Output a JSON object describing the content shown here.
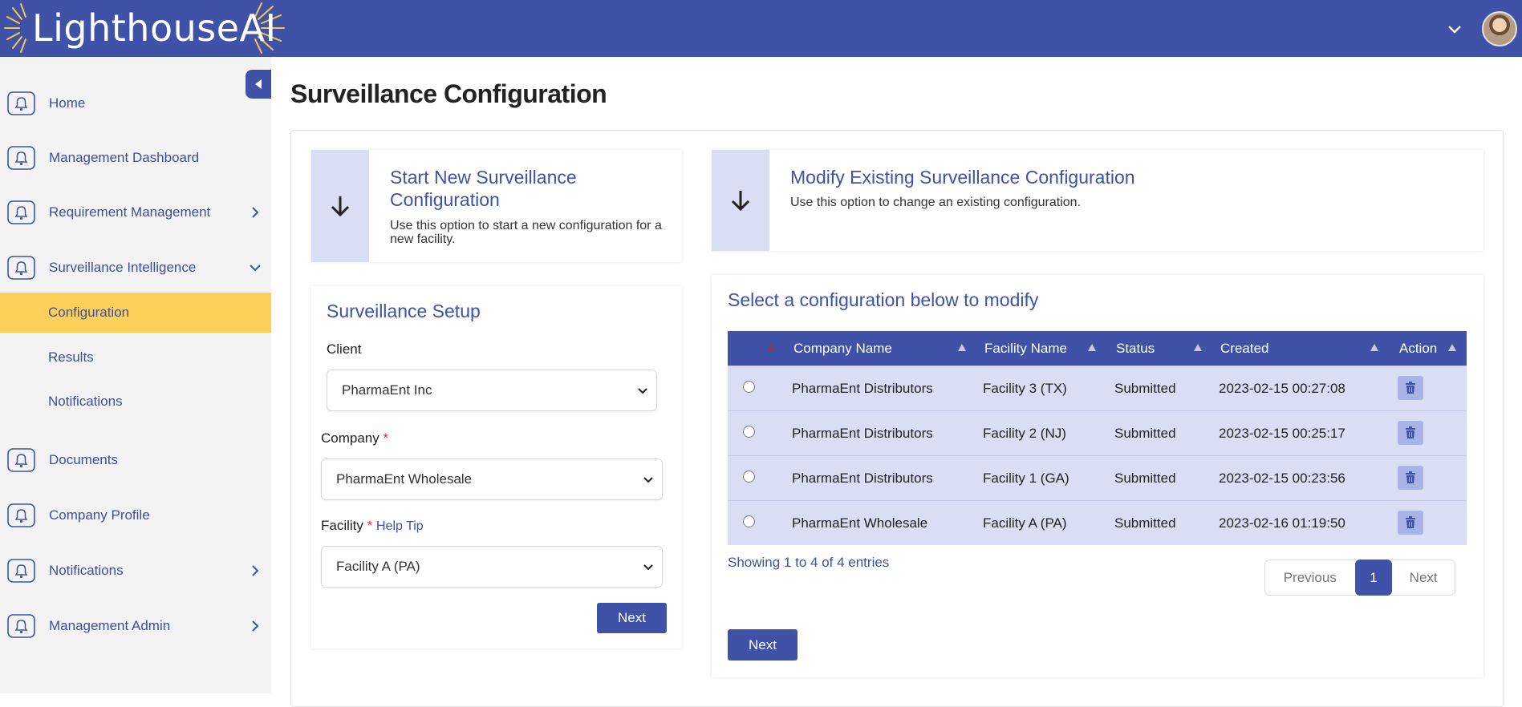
{
  "app": {
    "logo_text": "LighthouseAI"
  },
  "colors": {
    "primary": "#3f52a8",
    "active_nav": "#fdd05a",
    "light_blue": "#d9def5",
    "required": "#e0282e"
  },
  "sidebar": {
    "items": [
      {
        "label": "Home",
        "icon": "bell-icon"
      },
      {
        "label": "Management Dashboard",
        "icon": "bell-icon"
      },
      {
        "label": "Requirement Management",
        "icon": "bell-icon",
        "chevron": "right"
      },
      {
        "label": "Surveillance Intelligence",
        "icon": "bell-icon",
        "chevron": "down"
      },
      {
        "label": "Documents",
        "icon": "bell-icon"
      },
      {
        "label": "Company Profile",
        "icon": "bell-icon"
      },
      {
        "label": "Notifications",
        "icon": "bell-icon",
        "chevron": "right"
      },
      {
        "label": "Management Admin",
        "icon": "bell-icon",
        "chevron": "right"
      }
    ],
    "subitems": [
      {
        "label": "Configuration",
        "active": true
      },
      {
        "label": "Results"
      },
      {
        "label": "Notifications"
      }
    ]
  },
  "page": {
    "title": "Surveillance Configuration"
  },
  "start_option": {
    "title": "Start New Surveillance Configuration",
    "description": "Use this option to start a new configuration for a new facility."
  },
  "modify_option": {
    "title": "Modify Existing Surveillance Configuration",
    "description": "Use this option to change an existing configuration."
  },
  "setup": {
    "heading": "Surveillance Setup",
    "client_label": "Client",
    "client_value": "PharmaEnt Inc",
    "company_label": "Company",
    "company_value": "PharmaEnt Wholesale",
    "facility_label": "Facility",
    "help_tip": "Help Tip",
    "facility_value": "Facility A (PA)",
    "required_mark": "*",
    "next_label": "Next"
  },
  "config_table": {
    "heading": "Select a configuration below to modify",
    "columns": [
      "Company Name",
      "Facility Name",
      "Status",
      "Created",
      "Action"
    ],
    "rows": [
      {
        "company": "PharmaEnt Distributors",
        "facility": "Facility 3 (TX)",
        "status": "Submitted",
        "created": "2023-02-15 00:27:08"
      },
      {
        "company": "PharmaEnt Distributors",
        "facility": "Facility 2 (NJ)",
        "status": "Submitted",
        "created": "2023-02-15 00:25:17"
      },
      {
        "company": "PharmaEnt Distributors",
        "facility": "Facility 1 (GA)",
        "status": "Submitted",
        "created": "2023-02-15 00:23:56"
      },
      {
        "company": "PharmaEnt Wholesale",
        "facility": "Facility A (PA)",
        "status": "Submitted",
        "created": "2023-02-16 01:19:50"
      }
    ],
    "showing": "Showing 1 to 4 of 4 entries",
    "pagination": {
      "previous": "Previous",
      "current": "1",
      "next": "Next"
    },
    "next_label": "Next"
  }
}
